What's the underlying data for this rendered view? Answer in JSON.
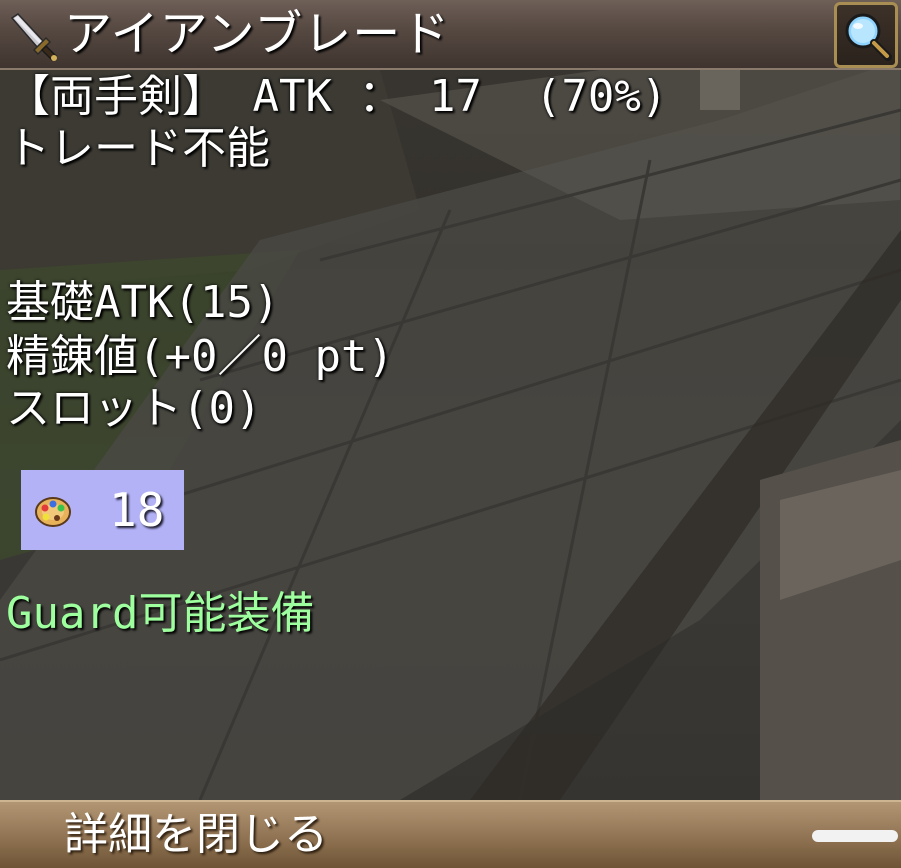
{
  "item": {
    "name": "アイアンブレード",
    "icon": "dagger-icon"
  },
  "header": {
    "magnifier_icon": "magnifier-icon"
  },
  "details": {
    "line1": "【両手剣】 ATK ： 17  (70%)",
    "line2": "トレード不能",
    "base_atk": "基礎ATK(15)",
    "refine": "精錬値(+0／0 pt)",
    "slot": "スロット(0)"
  },
  "stat_box": {
    "icon": "palette-icon",
    "value": "18",
    "background": "#b3b2f7"
  },
  "guard": {
    "text": "Guard可能装備",
    "color": "#9dff9d"
  },
  "footer": {
    "close_label": "詳細を閉じる"
  }
}
